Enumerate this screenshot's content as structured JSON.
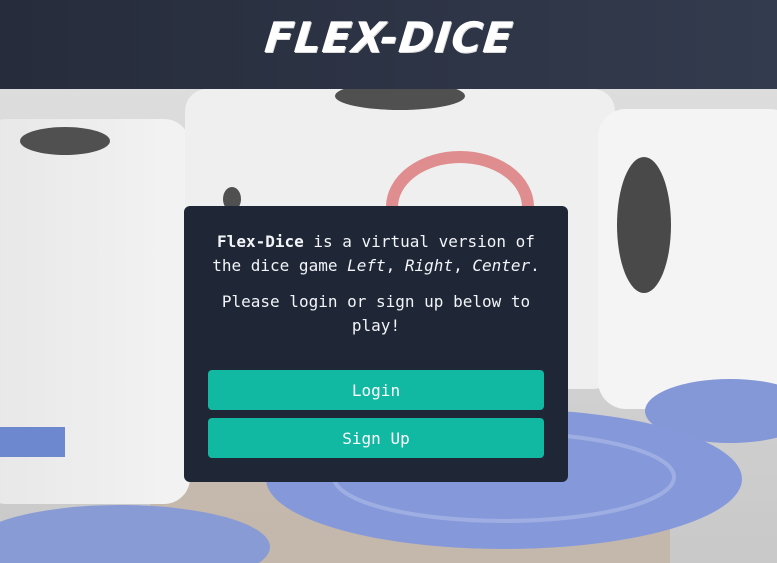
{
  "header": {
    "logo_text": "FLEX-DICE"
  },
  "card": {
    "intro": {
      "brand": "Flex-Dice",
      "text_before_game": " is a virtual version of the dice game ",
      "game_word_1": "Left",
      "sep_1": ", ",
      "game_word_2": "Right",
      "sep_2": ", ",
      "game_word_3": "Center",
      "end": "."
    },
    "prompt": "Please login or sign up below to play!",
    "login_label": "Login",
    "signup_label": "Sign Up"
  },
  "colors": {
    "header_bg": "#2b3242",
    "card_bg": "#1f2737",
    "button_bg": "#11b8a2",
    "chip_blue": "#5a73c7"
  }
}
